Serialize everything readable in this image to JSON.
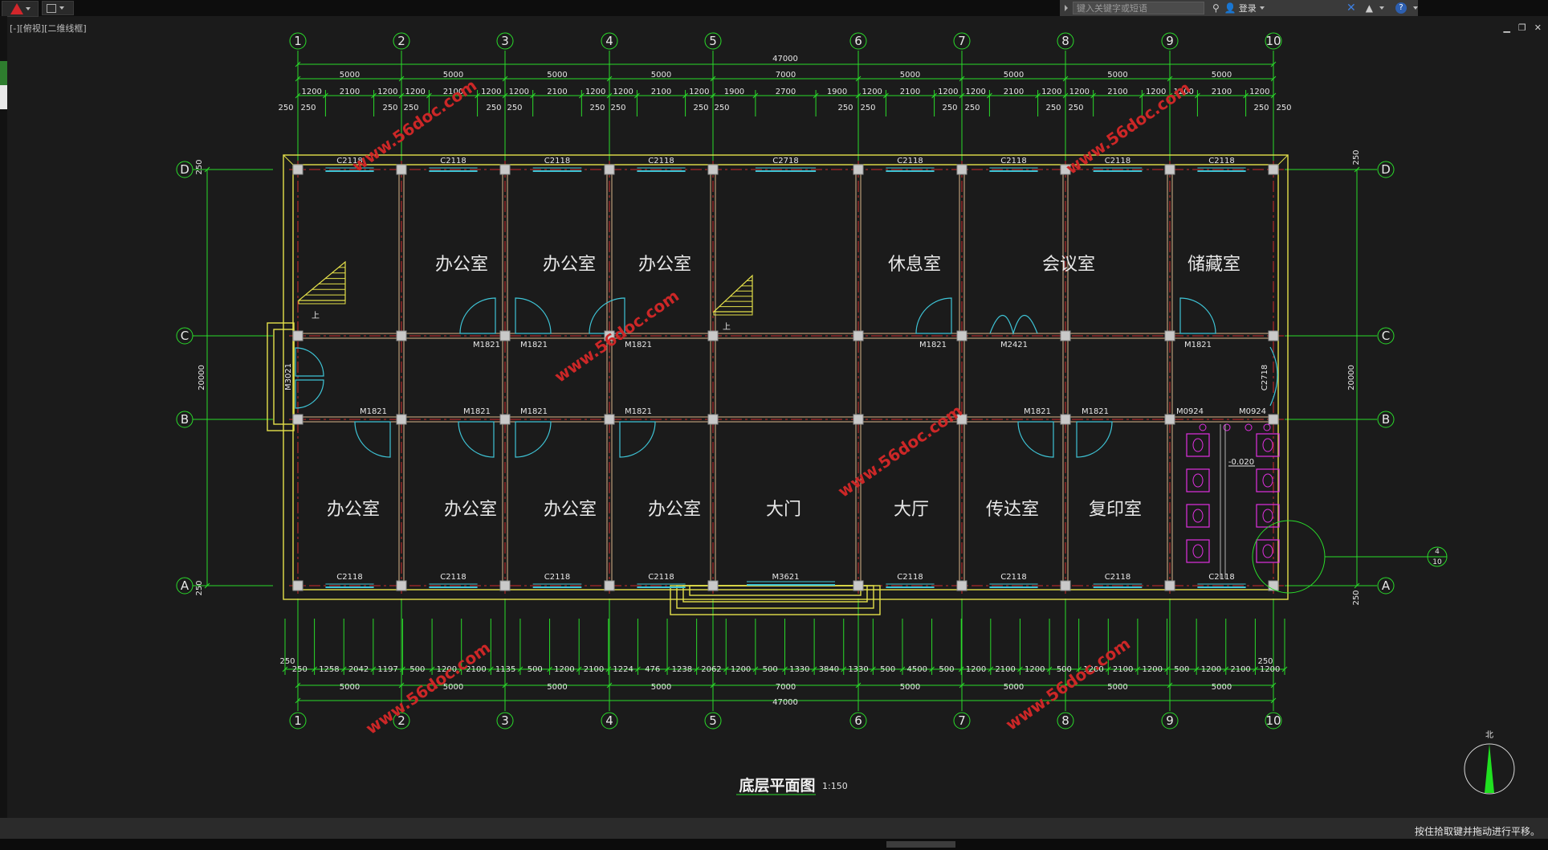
{
  "app": {
    "view_label": "[-][俯视][二维线框]",
    "search_placeholder": "键入关键字或短语",
    "login_label": "登录",
    "help_label": "?",
    "status_message": "按住拾取键并拖动进行平移。"
  },
  "colors": {
    "background": "#1b1b1b",
    "grid_line": "#2adb2a",
    "wall": "#e4e04a",
    "column": "#c9c9c9",
    "door": "#3ec4d6",
    "window": "#3ec4d6",
    "axis_center": "#cc2b2b",
    "fixture": "#e030e0",
    "watermark": "#cc2727"
  },
  "drawing": {
    "title": "底层平面图",
    "scale": "1:150",
    "north_label": "北",
    "axes_x": [
      "1",
      "2",
      "3",
      "4",
      "5",
      "6",
      "7",
      "8",
      "9",
      "10"
    ],
    "axes_y": [
      "D",
      "C",
      "B",
      "A"
    ],
    "section_marker": {
      "top": "4",
      "bottom": "10"
    },
    "overall_dim": "47000",
    "bay_dims_top": [
      "5000",
      "5000",
      "5000",
      "5000",
      "7000",
      "5000",
      "5000",
      "5000",
      "5000"
    ],
    "detail_dims_top": [
      "1200",
      "2100",
      "1200",
      "1200",
      "2100",
      "1200",
      "1200",
      "2100",
      "1200",
      "1200",
      "2100",
      "1200",
      "1900",
      "2700",
      "1900",
      "1200",
      "2100",
      "1200",
      "1200",
      "2100",
      "1200",
      "1200",
      "2100",
      "1200",
      "1200",
      "2100",
      "1200"
    ],
    "wall_dims_top": [
      "250",
      "250",
      "250",
      "250",
      "250",
      "250",
      "250",
      "250",
      "250",
      "250",
      "250",
      "250",
      "250",
      "250",
      "250",
      "250",
      "250",
      "250"
    ],
    "bay_dims_bottom": [
      "5000",
      "5000",
      "5000",
      "5000",
      "7000",
      "5000",
      "5000",
      "5000",
      "5000"
    ],
    "detail_dims_bottom": [
      "250",
      "1258",
      "2042",
      "1197",
      "500",
      "1200",
      "2100",
      "1135",
      "500",
      "1200",
      "2100",
      "1224",
      "476",
      "1238",
      "2062",
      "1200",
      "500",
      "1330",
      "3840",
      "1330",
      "500",
      "4500",
      "500",
      "1200",
      "2100",
      "1200",
      "500",
      "1200",
      "2100",
      "1200",
      "500",
      "1200",
      "2100",
      "1200"
    ],
    "wall_dims_bottom": [
      "250",
      "250"
    ],
    "vert_overall": "20000",
    "vert_edge_dims": [
      "250",
      "250",
      "250",
      "250"
    ],
    "rooms_top": [
      "办公室",
      "办公室",
      "办公室",
      "休息室",
      "会议室",
      "储藏室"
    ],
    "rooms_bottom": [
      "办公室",
      "办公室",
      "办公室",
      "办公室",
      "大门",
      "大厅",
      "传达室",
      "复印室"
    ],
    "windows_top": [
      "C2118",
      "C2118",
      "C2118",
      "C2118",
      "C2718",
      "C2118",
      "C2118",
      "C2118",
      "C2118"
    ],
    "windows_bottom": [
      "C2118",
      "C2118",
      "C2118",
      "C2118",
      "M3621",
      "C2118",
      "C2118",
      "C2118",
      "C2118"
    ],
    "doors_c": [
      "M1821",
      "M1821",
      "M1821",
      "M1821",
      "M2421",
      "M1821"
    ],
    "doors_b": [
      "M1821",
      "M1821",
      "M1821",
      "M1821",
      "M1821",
      "M1821",
      "M0924",
      "M0924"
    ],
    "side_labels": [
      "M3021",
      "C2718"
    ],
    "stair_label": "上",
    "level_mark": "-0.020",
    "watermark": "www.56doc.com"
  }
}
